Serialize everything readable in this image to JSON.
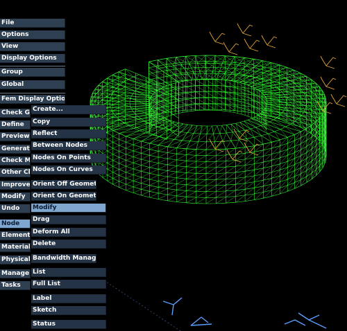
{
  "main_menu": {
    "items": [
      {
        "label": "File"
      },
      {
        "label": "Options"
      },
      {
        "label": "View"
      },
      {
        "label": "Display Options"
      },
      {
        "label": "Group"
      },
      {
        "label": "Global"
      },
      {
        "label": "Fem Display Options"
      },
      {
        "label": "Check Ge"
      },
      {
        "label": "Define"
      },
      {
        "label": "Preview"
      },
      {
        "label": "Generate"
      },
      {
        "label": "Check M"
      },
      {
        "label": "Other Ch"
      },
      {
        "label": "Improve"
      },
      {
        "label": "Modify"
      },
      {
        "label": "Undo"
      },
      {
        "label": "Node",
        "active": true
      },
      {
        "label": "Element"
      },
      {
        "label": "Materials"
      },
      {
        "label": "Physical"
      },
      {
        "label": "Manage"
      },
      {
        "label": "Tasks"
      }
    ]
  },
  "node_submenu": {
    "items": [
      {
        "label": "Create..."
      },
      {
        "label": "Copy"
      },
      {
        "label": "Reflect"
      },
      {
        "label": "Between Nodes"
      },
      {
        "label": "Nodes On Points"
      },
      {
        "label": "Nodes On Curves"
      },
      {
        "label": "Orient Off Geometry"
      },
      {
        "label": "Orient On Geometry"
      },
      {
        "label": "Modify",
        "active": true
      },
      {
        "label": "Drag"
      },
      {
        "label": "Deform All"
      },
      {
        "label": "Delete"
      },
      {
        "label": "Bandwidth Manage"
      },
      {
        "label": "List"
      },
      {
        "label": "Full List"
      },
      {
        "label": "Label"
      },
      {
        "label": "Sketch"
      },
      {
        "label": "Status"
      }
    ]
  },
  "colors": {
    "mesh": "#33ff33",
    "constraint": "#e8a83a",
    "axis": "#5aa0ff",
    "menu_bg": "#2f3f52",
    "menu_active": "#7fa6cf"
  }
}
